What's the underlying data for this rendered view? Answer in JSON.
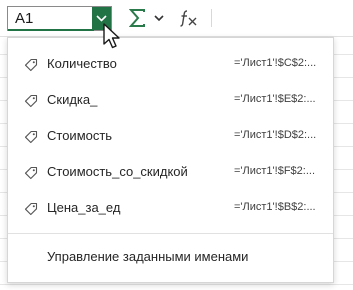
{
  "name_box": {
    "value": "A1"
  },
  "toolbar": {
    "autosum_icon": "sigma-icon",
    "autosum_dropdown_icon": "chevron-down-icon",
    "function_icon": "fx-icon"
  },
  "named_ranges": [
    {
      "name": "Количество",
      "ref": "='Лист1'!$C$2:..."
    },
    {
      "name": "Скидка_",
      "ref": "='Лист1'!$E$2:..."
    },
    {
      "name": "Стоимость",
      "ref": "='Лист1'!$D$2:..."
    },
    {
      "name": "Стоимость_со_скидкой",
      "ref": "='Лист1'!$F$2:..."
    },
    {
      "name": "Цена_за_ед",
      "ref": "='Лист1'!$B$2:..."
    }
  ],
  "manage_names_label": "Управление заданными именами",
  "colors": {
    "accent": "#217346",
    "text": "#262626",
    "border": "#d6d6d6"
  }
}
